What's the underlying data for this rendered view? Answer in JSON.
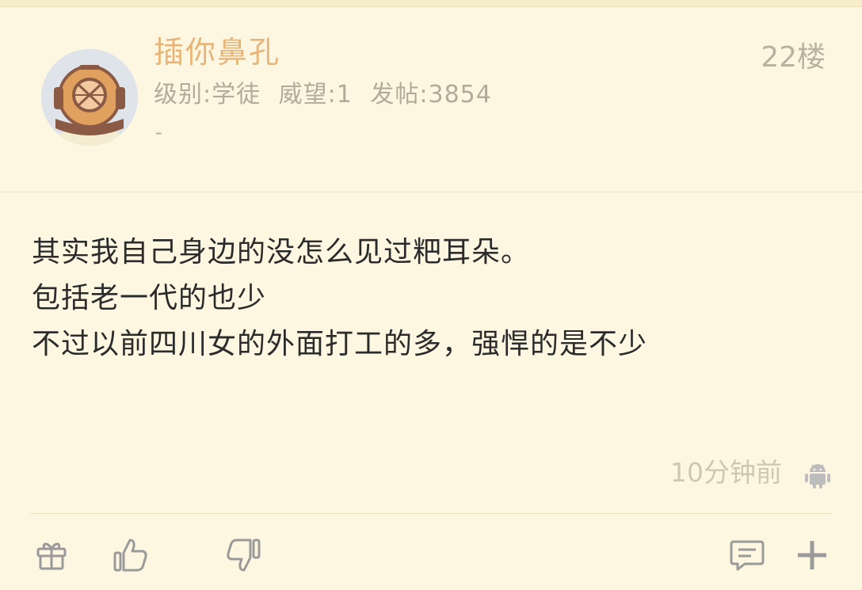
{
  "post": {
    "author": {
      "name": "插你鼻孔",
      "level": "级别:学徒",
      "reputation": "威望:1",
      "posts": "发帖:3854",
      "signature": "-"
    },
    "floor": "22楼",
    "content": [
      "其实我自己身边的没怎么见过粑耳朵。",
      "包括老一代的也少",
      "不过以前四川女的外面打工的多，强悍的是不少"
    ],
    "time": "10分钟前",
    "device_icon": "android-icon"
  },
  "actions": {
    "gift": "gift-icon",
    "like": "thumbs-up-icon",
    "dislike": "thumbs-down-icon",
    "comment": "comment-icon",
    "add": "plus-icon"
  },
  "colors": {
    "background": "#fdf7e2",
    "username": "#e8b578",
    "muted_text": "#b2ab99",
    "body_text": "#2b2b2b",
    "icon": "#9a9a9a"
  }
}
